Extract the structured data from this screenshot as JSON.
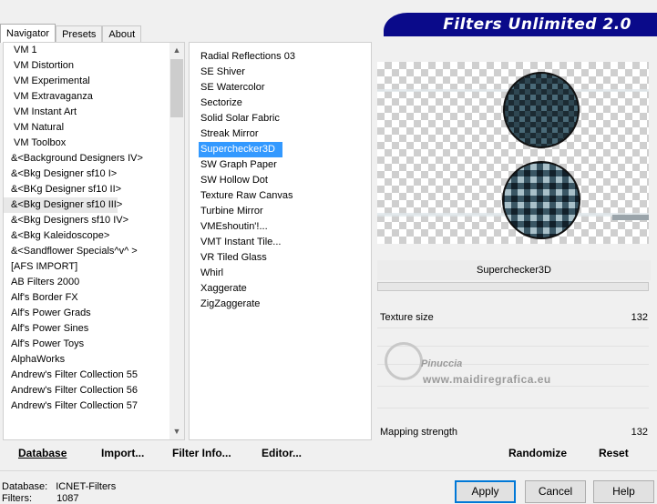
{
  "tabs": [
    "Navigator",
    "Presets",
    "About"
  ],
  "banner_title": "Filters Unlimited 2.0",
  "categories": [
    "VM 1",
    "VM Distortion",
    "VM Experimental",
    "VM Extravaganza",
    "VM Instant Art",
    "VM Natural",
    "VM Toolbox",
    "&<Background Designers IV>",
    "&<Bkg Designer sf10 I>",
    "&<BKg Designer sf10 II>",
    "&<Bkg Designer sf10 III>",
    "&<Bkg Designers sf10 IV>",
    "&<Bkg Kaleidoscope>",
    "&<Sandflower Specials^v^ >",
    "[AFS IMPORT]",
    "AB Filters 2000",
    "Alf's Border FX",
    "Alf's Power Grads",
    "Alf's Power Sines",
    "Alf's Power Toys",
    "AlphaWorks",
    "Andrew's Filter Collection 55",
    "Andrew's Filter Collection 56",
    "Andrew's Filter Collection 57"
  ],
  "filters": [
    "Radial Reflections 03",
    "SE Shiver",
    "SE Watercolor",
    "Sectorize",
    "Solid Solar Fabric",
    "Streak Mirror",
    "Superchecker3D",
    "SW Graph Paper",
    "SW Hollow Dot",
    "Texture Raw Canvas",
    "Turbine Mirror",
    "VMEshoutin'!...",
    "VMT Instant Tile...",
    "VR Tiled Glass",
    "Whirl",
    "Xaggerate",
    "ZigZaggerate"
  ],
  "selected_filter": "Superchecker3D",
  "params": [
    {
      "label": "Texture size",
      "value": "132"
    },
    {
      "label": "Mapping strength",
      "value": "132"
    }
  ],
  "watermark": {
    "line1": "Pinuccia",
    "line2": "www.maidiregrafica.eu"
  },
  "left_buttons": [
    "Database",
    "Import...",
    "Filter Info...",
    "Editor..."
  ],
  "right_buttons": [
    "Randomize",
    "Reset"
  ],
  "status": {
    "database_label": "Database:",
    "database_value": "ICNET-Filters",
    "filters_label": "Filters:",
    "filters_value": "1087"
  },
  "dialog_buttons": [
    "Apply",
    "Cancel",
    "Help"
  ]
}
